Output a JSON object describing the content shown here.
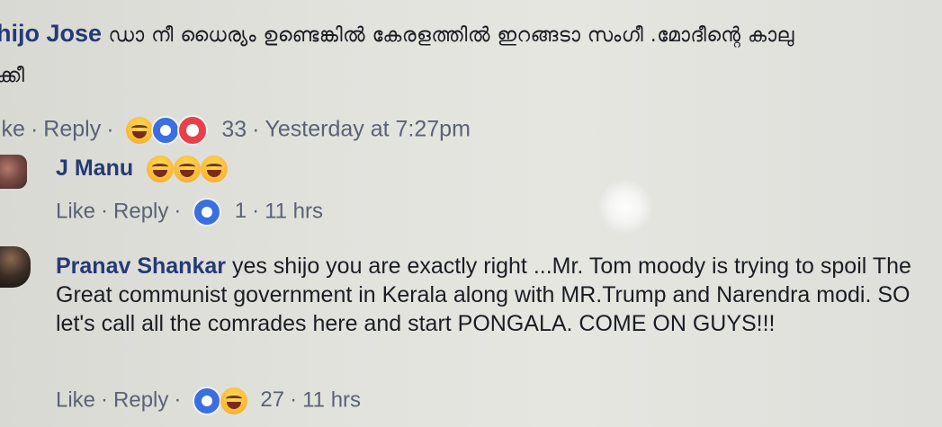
{
  "comments": [
    {
      "name": "hijo Jose",
      "text": "ഡാ നീ ധൈര്യം ഉണ്ടെങ്കിൽ കേരളത്തിൽ ഇറങ്ങടാ സംഗീ .മോദീന്റെ കാലു",
      "text_cont": "ക്കീ",
      "like_label": "ike",
      "reply_label": "Reply",
      "reaction_icons": [
        "laughing-emoji",
        "like",
        "love"
      ],
      "reaction_count": "33",
      "timestamp": "Yesterday at 7:27pm"
    },
    {
      "name": "J Manu",
      "emojis": [
        "laughing-emoji",
        "laughing-emoji",
        "laughing-emoji"
      ],
      "like_label": "Like",
      "reply_label": "Reply",
      "reaction_icons": [
        "like"
      ],
      "reaction_count": "1",
      "timestamp": "11 hrs"
    },
    {
      "name": "Pranav Shankar",
      "text": "yes shijo you are exactly right ...Mr. Tom moody is trying to spoil The Great communist government in Kerala along with MR.Trump and Narendra modi. SO let's call all the comrades here and start PONGALA. COME ON GUYS!!!",
      "like_label": "Like",
      "reply_label": "Reply",
      "reaction_icons": [
        "like",
        "laughing-emoji"
      ],
      "reaction_count": "27",
      "timestamp": "11 hrs"
    }
  ],
  "colors": {
    "name": "#243a74",
    "meta": "#5a6275",
    "like_blue": "#3b6fe0",
    "love_red": "#e8404a",
    "emoji_yellow": "#f7b733"
  }
}
